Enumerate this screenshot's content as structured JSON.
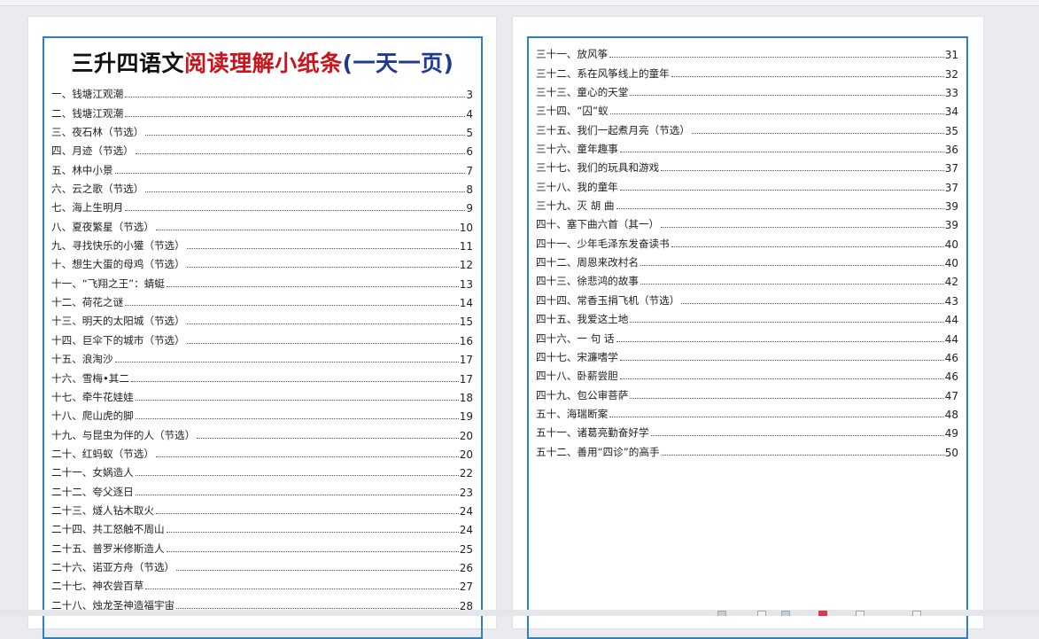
{
  "page1": {
    "title": {
      "part1": "三升四语文",
      "part2": "阅读理解小纸条",
      "part3": "(一天一页)"
    },
    "entries": [
      {
        "label": "一、钱塘江观潮",
        "page": "3"
      },
      {
        "label": "二、钱塘江观潮",
        "page": "4"
      },
      {
        "label": "三、夜石林（节选）",
        "page": "5"
      },
      {
        "label": "四、月迹（节选）",
        "page": "6"
      },
      {
        "label": "五、林中小景",
        "page": "7"
      },
      {
        "label": "六、云之歌（节选）",
        "page": "8"
      },
      {
        "label": "七、海上生明月",
        "page": "9"
      },
      {
        "label": "八、夏夜繁星（节选）",
        "page": "10"
      },
      {
        "label": "九、寻找快乐的小獾（节选）",
        "page": "11"
      },
      {
        "label": "十、想生大蛋的母鸡（节选）",
        "page": "12"
      },
      {
        "label": "十一、“飞翔之王”：蜻蜓",
        "page": "13"
      },
      {
        "label": "十二、荷花之谜",
        "page": "14"
      },
      {
        "label": "十三、明天的太阳城（节选）",
        "page": "15"
      },
      {
        "label": "十四、巨伞下的城市（节选）",
        "page": "16"
      },
      {
        "label": "十五、浪淘沙",
        "page": "17"
      },
      {
        "label": "十六、雪梅•其二",
        "page": "17"
      },
      {
        "label": "十七、牵牛花娃娃",
        "page": "18"
      },
      {
        "label": "十八、爬山虎的脚",
        "page": "19"
      },
      {
        "label": "十九、与昆虫为伴的人（节选）",
        "page": "20"
      },
      {
        "label": "二十、红蚂蚁（节选）",
        "page": "20"
      },
      {
        "label": "二十一、女娲造人",
        "page": "22"
      },
      {
        "label": "二十二、夸父逐日",
        "page": "23"
      },
      {
        "label": "二十三、燧人钻木取火",
        "page": "24"
      },
      {
        "label": "二十四、共工怒触不周山",
        "page": "24"
      },
      {
        "label": "二十五、普罗米修斯造人",
        "page": "25"
      },
      {
        "label": "二十六、诺亚方舟（节选）",
        "page": "26"
      },
      {
        "label": "二十七、神农尝百草",
        "page": "27"
      },
      {
        "label": "二十八、烛龙圣神造福宇宙",
        "page": "28"
      }
    ]
  },
  "page2": {
    "entries": [
      {
        "label": "三十一、放风筝",
        "page": "31"
      },
      {
        "label": "三十二、系在风筝线上的童年",
        "page": "32"
      },
      {
        "label": "三十三、童心的天堂",
        "page": "33"
      },
      {
        "label": "三十四、“囚”蚁",
        "page": "34"
      },
      {
        "label": "三十五、我们一起煮月亮（节选）",
        "page": "35"
      },
      {
        "label": "三十六、童年趣事",
        "page": "36"
      },
      {
        "label": "三十七、我们的玩具和游戏",
        "page": "37"
      },
      {
        "label": "三十八、我的童年",
        "page": "37"
      },
      {
        "label": "三十九、灭 胡 曲",
        "page": "39"
      },
      {
        "label": "四十、塞下曲六首（其一）",
        "page": "39"
      },
      {
        "label": "四十一、少年毛泽东发奋读书",
        "page": "40"
      },
      {
        "label": "四十二、周恩来改村名",
        "page": "40"
      },
      {
        "label": "四十三、徐悲鸿的故事",
        "page": "42"
      },
      {
        "label": "四十四、常香玉捐飞机（节选）",
        "page": "43"
      },
      {
        "label": "四十五、我爱这土地",
        "page": "44"
      },
      {
        "label": "四十六、一 句 话",
        "page": "44"
      },
      {
        "label": "四十七、宋濂嗜学",
        "page": "46"
      },
      {
        "label": "四十八、卧薪尝胆",
        "page": "46"
      },
      {
        "label": "四十九、包公审菩萨",
        "page": "47"
      },
      {
        "label": "五十、海瑞断案",
        "page": "48"
      },
      {
        "label": "五十一、诸葛亮勤奋好学",
        "page": "49"
      },
      {
        "label": "五十二、善用“四诊”的高手",
        "page": "50"
      }
    ]
  },
  "colors": {
    "frame": "#2f7fc6",
    "title_red": "#c8141d",
    "title_blue": "#203a8f"
  }
}
